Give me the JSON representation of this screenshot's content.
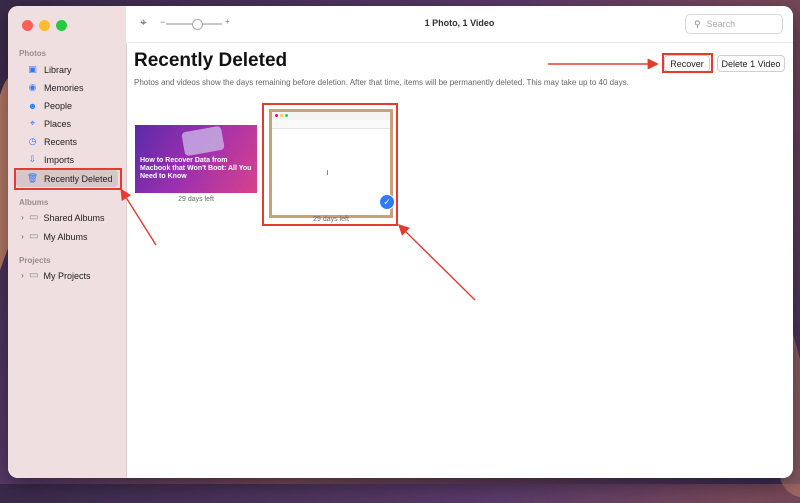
{
  "window": {
    "title": "1 Photo, 1 Video"
  },
  "toolbar": {
    "slider_minus": "−",
    "slider_plus": "+",
    "search_placeholder": "Search"
  },
  "sidebar": {
    "photos_label": "Photos",
    "photos_items": [
      {
        "label": "Library",
        "icon": "library-icon"
      },
      {
        "label": "Memories",
        "icon": "memories-icon"
      },
      {
        "label": "People",
        "icon": "people-icon"
      },
      {
        "label": "Places",
        "icon": "places-icon"
      },
      {
        "label": "Recents",
        "icon": "recents-icon"
      },
      {
        "label": "Imports",
        "icon": "imports-icon"
      },
      {
        "label": "Recently Deleted",
        "icon": "trash-icon",
        "selected": true
      }
    ],
    "albums_label": "Albums",
    "albums_items": [
      {
        "label": "Shared Albums",
        "icon": "shared-albums-icon"
      },
      {
        "label": "My Albums",
        "icon": "folder-icon"
      }
    ],
    "projects_label": "Projects",
    "projects_items": [
      {
        "label": "My Projects",
        "icon": "folder-icon"
      }
    ]
  },
  "main": {
    "title": "Recently Deleted",
    "description": "Photos and videos show the days remaining before deletion. After that time, items will be permanently deleted. This may take up to 40 days.",
    "recover_label": "Recover",
    "delete_label": "Delete 1 Video",
    "items": [
      {
        "headline": "How to Recover Data from Macbook that Won't Boot: All You Need to Know",
        "caption": "29 days left",
        "selected": false
      },
      {
        "caption": "29 days left",
        "selected": true
      }
    ]
  },
  "colors": {
    "accent": "#2f7bf6",
    "annotation_red": "#e33b2e",
    "sidebar_bg": "#f0dfe0"
  }
}
